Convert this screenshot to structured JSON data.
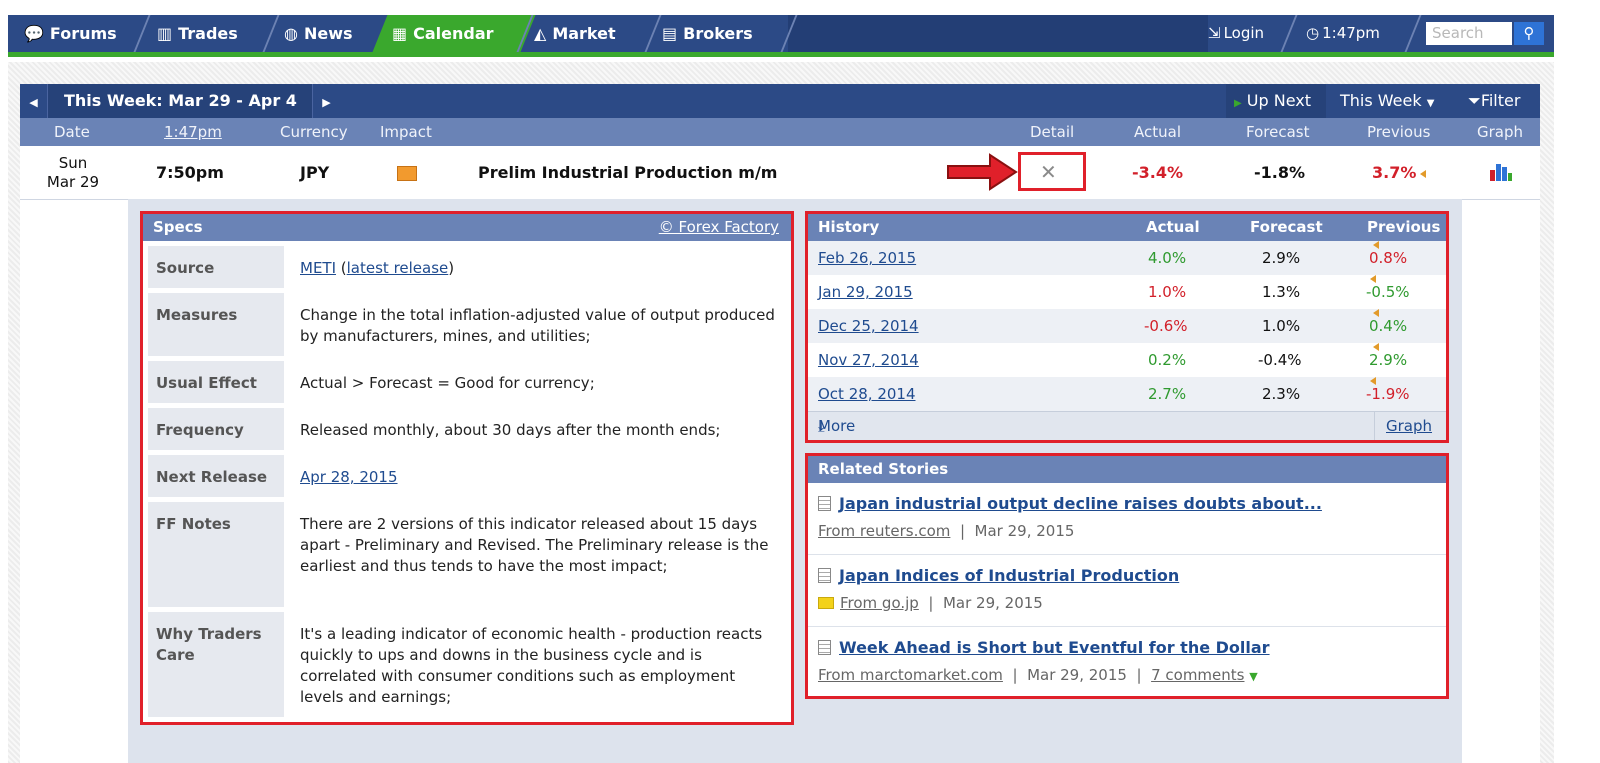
{
  "nav": {
    "tabs": [
      {
        "label": "Forums",
        "icon": "chat-bubbles-icon"
      },
      {
        "label": "Trades",
        "icon": "bar-chart-icon"
      },
      {
        "label": "News",
        "icon": "globe-icon"
      },
      {
        "label": "Calendar",
        "icon": "calendar-icon"
      },
      {
        "label": "Market",
        "icon": "mountain-chart-icon"
      },
      {
        "label": "Brokers",
        "icon": "building-icon"
      }
    ],
    "login": "Login",
    "time": "1:47pm",
    "search_placeholder": "Search",
    "active_color": "#3aa82d",
    "bar_color": "#2c4a86"
  },
  "calendar": {
    "week_label": "This Week: Mar 29 - Apr 4",
    "up_next": "Up Next",
    "this_week": "This Week",
    "filter": "Filter",
    "columns": {
      "date": "Date",
      "time": "1:47pm",
      "currency": "Currency",
      "impact": "Impact",
      "detail": "Detail",
      "actual": "Actual",
      "forecast": "Forecast",
      "previous": "Previous",
      "graph": "Graph"
    },
    "event": {
      "day": "Sun",
      "date": "Mar 29",
      "time": "7:50pm",
      "currency": "JPY",
      "impact": "medium",
      "name": "Prelim Industrial Production m/m",
      "actual": "-3.4%",
      "forecast": "-1.8%",
      "previous": "3.7%"
    }
  },
  "specs": {
    "title": "Specs",
    "credit": "© Forex Factory",
    "rows": [
      {
        "label": "Source",
        "link1": "METI",
        "text1": " (",
        "link2": "latest release",
        "text2": ")"
      },
      {
        "label": "Measures",
        "value": "Change in the total inflation-adjusted value of output produced by manufacturers, mines, and utilities;"
      },
      {
        "label": "Usual Effect",
        "value": "Actual > Forecast = Good for currency;"
      },
      {
        "label": "Frequency",
        "value": "Released monthly, about 30 days after the month ends;"
      },
      {
        "label": "Next Release",
        "link": "Apr 28, 2015"
      },
      {
        "label": "FF Notes",
        "value": "There are 2 versions of this indicator released about 15 days apart - Preliminary and Revised. The Preliminary release is the earliest and thus tends to have the most impact;"
      },
      {
        "label": "Why Traders Care",
        "value": "It's a leading indicator of economic health - production reacts quickly to ups and downs in the business cycle and is correlated with consumer conditions such as employment levels and earnings;"
      }
    ]
  },
  "history": {
    "title": "History",
    "columns": [
      "Actual",
      "Forecast",
      "Previous"
    ],
    "rows": [
      {
        "date": "Feb 26, 2015",
        "actual": "4.0%",
        "forecast": "2.9%",
        "previous": "0.8%"
      },
      {
        "date": "Jan 29, 2015",
        "actual": "1.0%",
        "forecast": "1.3%",
        "previous": "-0.5%"
      },
      {
        "date": "Dec 25, 2014",
        "actual": "-0.6%",
        "forecast": "1.0%",
        "previous": "0.4%"
      },
      {
        "date": "Nov 27, 2014",
        "actual": "0.2%",
        "forecast": "-0.4%",
        "previous": "2.9%"
      },
      {
        "date": "Oct 28, 2014",
        "actual": "2.7%",
        "forecast": "2.3%",
        "previous": "-1.9%"
      }
    ],
    "more": "More",
    "graph": "Graph"
  },
  "stories": {
    "title": "Related Stories",
    "items": [
      {
        "title": "Japan industrial output decline raises doubts about...",
        "source": "From reuters.com",
        "date": "Mar 29, 2015"
      },
      {
        "title": "Japan Indices of Industrial Production",
        "source": "From go.jp",
        "date": "Mar 29, 2015"
      },
      {
        "title": "Week Ahead is Short but Eventful for the Dollar",
        "source": "From marctomarket.com",
        "date": "Mar 29, 2015",
        "comments": "7 comments"
      }
    ]
  }
}
